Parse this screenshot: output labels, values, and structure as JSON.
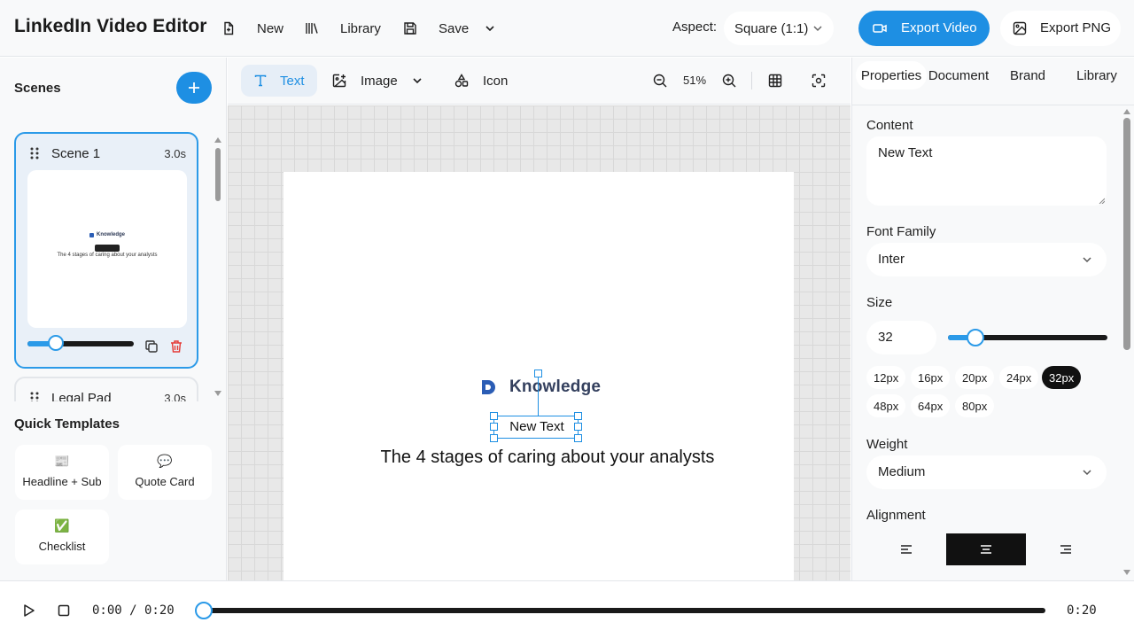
{
  "app": {
    "title": "LinkedIn Video Editor"
  },
  "toolbar": {
    "new_label": "New",
    "library_label": "Library",
    "save_label": "Save",
    "aspect_label": "Aspect:",
    "aspect_value": "Square (1:1)",
    "export_video_label": "Export Video",
    "export_png_label": "Export PNG"
  },
  "sidebar": {
    "scenes_title": "Scenes",
    "scenes": [
      {
        "name": "Scene 1",
        "duration": "3.0s",
        "selected": true,
        "thumb_logo": "Knowledge",
        "thumb_text": "The 4 stages of caring about your analysts",
        "slider_fraction": 0.27
      },
      {
        "name": "Legal Pad",
        "duration": "3.0s",
        "selected": false
      }
    ],
    "quick_templates_title": "Quick Templates",
    "templates": [
      {
        "icon": "📰",
        "label": "Headline + Sub"
      },
      {
        "icon": "💬",
        "label": "Quote Card"
      },
      {
        "icon": "✅",
        "label": "Checklist"
      }
    ]
  },
  "canvas_toolbar": {
    "text_label": "Text",
    "image_label": "Image",
    "icon_label": "Icon",
    "zoom": "51%"
  },
  "canvas": {
    "logo_text": "Knowledge",
    "selected_text": "New Text",
    "headline": "The 4 stages of caring about your analysts"
  },
  "panel": {
    "tabs": [
      "Properties",
      "Document",
      "Brand",
      "Library"
    ],
    "active_tab": "Properties",
    "content_label": "Content",
    "content_value": "New Text",
    "font_family_label": "Font Family",
    "font_family_value": "Inter",
    "size_label": "Size",
    "size_value": "32",
    "size_slider_fraction": 0.17,
    "size_presets": [
      "12px",
      "16px",
      "20px",
      "24px",
      "32px",
      "48px",
      "64px",
      "80px"
    ],
    "active_size": "32px",
    "weight_label": "Weight",
    "weight_value": "Medium",
    "alignment_label": "Alignment",
    "alignment_value": "center"
  },
  "playback": {
    "current_time": "0:00 / 0:20",
    "total_time": "0:20",
    "progress_fraction": 0
  },
  "colors": {
    "accent": "#1e8fe3",
    "danger": "#e53935",
    "dark": "#111111"
  }
}
